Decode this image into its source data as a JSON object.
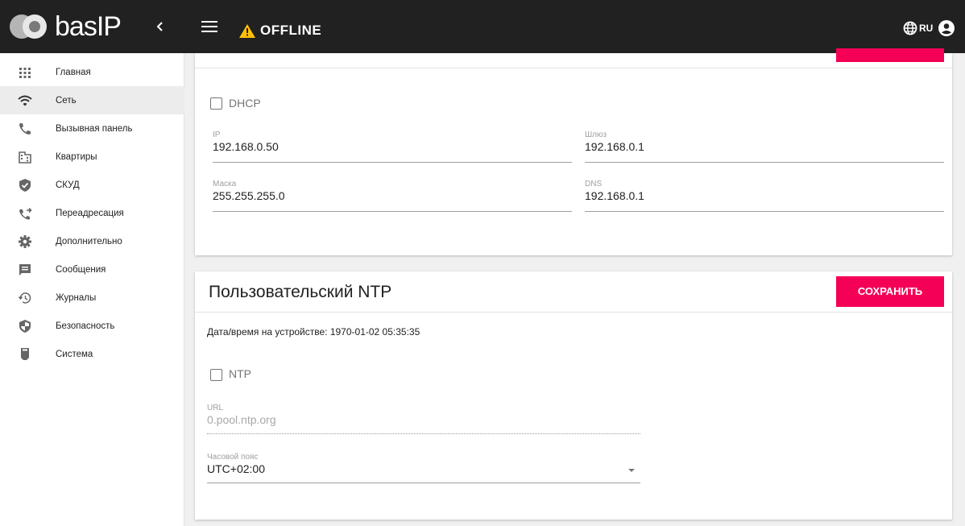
{
  "header": {
    "logo_text": "basIP",
    "status_text": "OFFLINE",
    "language": "RU",
    "colors": {
      "bar": "#212121",
      "warning": "#ffc107"
    }
  },
  "sidebar": {
    "items": [
      {
        "label": "Главная",
        "icon": "apps-grid-icon",
        "active": false
      },
      {
        "label": "Сеть",
        "icon": "wifi-icon",
        "active": true
      },
      {
        "label": "Вызывная панель",
        "icon": "phone-icon",
        "active": false
      },
      {
        "label": "Квартиры",
        "icon": "building-icon",
        "active": false
      },
      {
        "label": "СКУД",
        "icon": "shield-check-icon",
        "active": false
      },
      {
        "label": "Переадресация",
        "icon": "phone-forward-icon",
        "active": false
      },
      {
        "label": "Дополнительно",
        "icon": "gear-icon",
        "active": false
      },
      {
        "label": "Сообщения",
        "icon": "message-icon",
        "active": false
      },
      {
        "label": "Журналы",
        "icon": "history-icon",
        "active": false
      },
      {
        "label": "Безопасность",
        "icon": "security-shield-icon",
        "active": false
      },
      {
        "label": "Система",
        "icon": "system-chip-icon",
        "active": false
      }
    ]
  },
  "network_card": {
    "dhcp_label": "DHCP",
    "dhcp_checked": false,
    "ip": {
      "label": "IP",
      "value": "192.168.0.50"
    },
    "gateway": {
      "label": "Шлюз",
      "value": "192.168.0.1"
    },
    "mask": {
      "label": "Маска",
      "value": "255.255.255.0"
    },
    "dns": {
      "label": "DNS",
      "value": "192.168.0.1"
    }
  },
  "ntp_card": {
    "title": "Пользовательский NTP",
    "save_label": "СОХРАНИТЬ",
    "datetime_text": "Дата/время на устройстве: 1970-01-02 05:35:35",
    "ntp_label": "NTP",
    "ntp_checked": false,
    "url": {
      "label": "URL",
      "value": "0.pool.ntp.org"
    },
    "timezone": {
      "label": "Часовой пояс",
      "value": "UTC+02:00"
    }
  },
  "accent_color": "#f50057"
}
